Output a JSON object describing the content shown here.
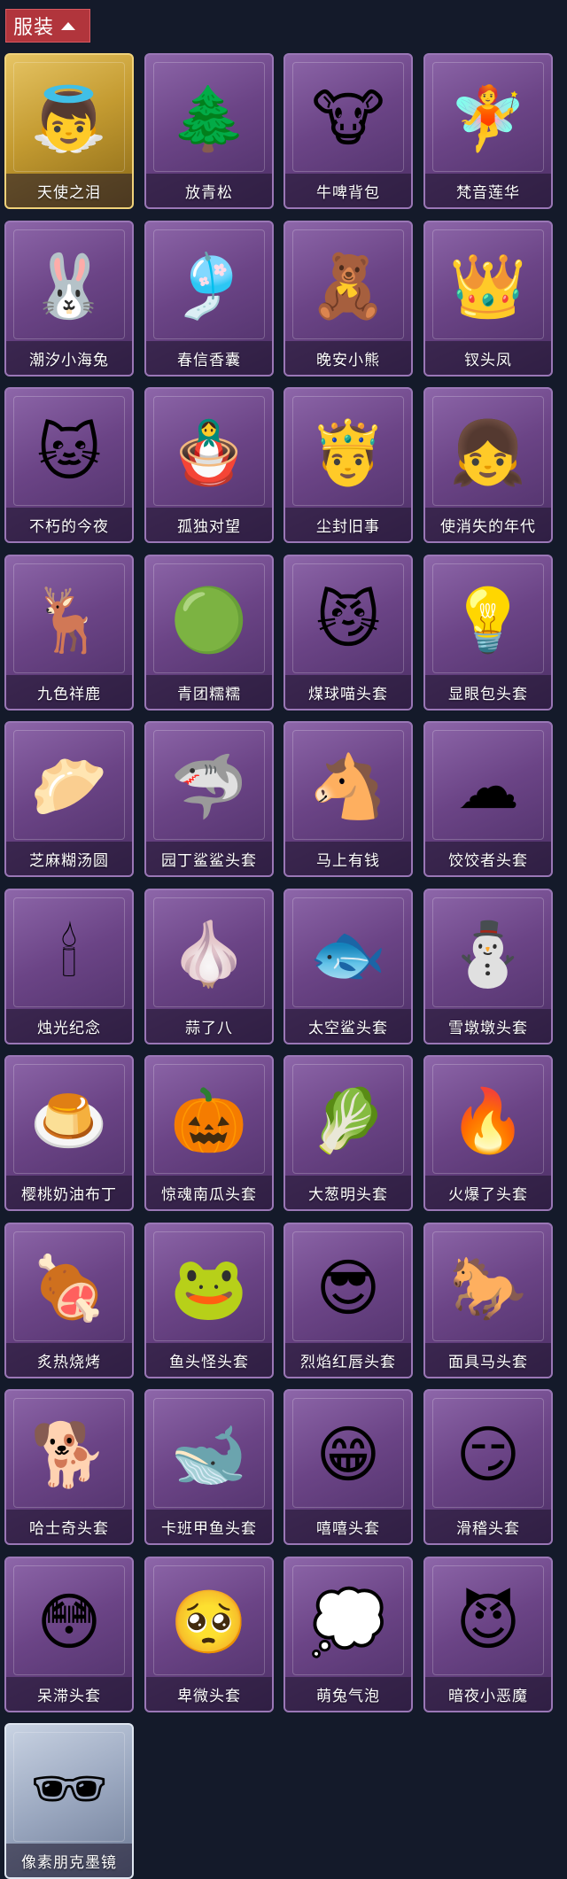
{
  "header": {
    "title": "服装",
    "icon": "caret-up-icon",
    "color": "#b1353c"
  },
  "items": [
    {
      "label": "天使之泪",
      "glyph": "👼",
      "style": "gold"
    },
    {
      "label": "放青松",
      "glyph": "🌲",
      "style": "purple"
    },
    {
      "label": "牛啤背包",
      "glyph": "🐮",
      "style": "purple"
    },
    {
      "label": "梵音莲华",
      "glyph": "🧚",
      "style": "purple"
    },
    {
      "label": "潮汐小海兔",
      "glyph": "🐰",
      "style": "purple"
    },
    {
      "label": "春信香囊",
      "glyph": "🎐",
      "style": "purple"
    },
    {
      "label": "晚安小熊",
      "glyph": "🧸",
      "style": "purple"
    },
    {
      "label": "钗头凤",
      "glyph": "👑",
      "style": "purple"
    },
    {
      "label": "不朽的今夜",
      "glyph": "🐱",
      "style": "purple"
    },
    {
      "label": "孤独对望",
      "glyph": "🪆",
      "style": "purple"
    },
    {
      "label": "尘封旧事",
      "glyph": "🤴",
      "style": "purple"
    },
    {
      "label": "使消失的年代",
      "glyph": "👧",
      "style": "purple"
    },
    {
      "label": "九色祥鹿",
      "glyph": "🦌",
      "style": "purple"
    },
    {
      "label": "青团糯糯",
      "glyph": "🟢",
      "style": "purple"
    },
    {
      "label": "煤球喵头套",
      "glyph": "😼",
      "style": "purple"
    },
    {
      "label": "显眼包头套",
      "glyph": "💡",
      "style": "purple"
    },
    {
      "label": "芝麻糊汤圆",
      "glyph": "🥟",
      "style": "purple"
    },
    {
      "label": "园丁鲨鲨头套",
      "glyph": "🦈",
      "style": "purple"
    },
    {
      "label": "马上有钱",
      "glyph": "🐴",
      "style": "purple"
    },
    {
      "label": "饺饺者头套",
      "glyph": "☁",
      "style": "purple"
    },
    {
      "label": "烛光纪念",
      "glyph": "🕯",
      "style": "purple"
    },
    {
      "label": "蒜了八",
      "glyph": "🧄",
      "style": "purple"
    },
    {
      "label": "太空鲨头套",
      "glyph": "🐟",
      "style": "purple"
    },
    {
      "label": "雪墩墩头套",
      "glyph": "⛄",
      "style": "purple"
    },
    {
      "label": "樱桃奶油布丁",
      "glyph": "🍮",
      "style": "purple"
    },
    {
      "label": "惊魂南瓜头套",
      "glyph": "🎃",
      "style": "purple"
    },
    {
      "label": "大葱明头套",
      "glyph": "🥬",
      "style": "purple"
    },
    {
      "label": "火爆了头套",
      "glyph": "🔥",
      "style": "purple"
    },
    {
      "label": "炙热烧烤",
      "glyph": "🍖",
      "style": "purple"
    },
    {
      "label": "鱼头怪头套",
      "glyph": "🐸",
      "style": "purple"
    },
    {
      "label": "烈焰红唇头套",
      "glyph": "😎",
      "style": "purple"
    },
    {
      "label": "面具马头套",
      "glyph": "🐎",
      "style": "purple"
    },
    {
      "label": "哈士奇头套",
      "glyph": "🐕",
      "style": "purple"
    },
    {
      "label": "卡班甲鱼头套",
      "glyph": "🐋",
      "style": "purple"
    },
    {
      "label": "嘻嘻头套",
      "glyph": "😁",
      "style": "purple"
    },
    {
      "label": "滑稽头套",
      "glyph": "😏",
      "style": "purple"
    },
    {
      "label": "呆滞头套",
      "glyph": "😳",
      "style": "purple"
    },
    {
      "label": "卑微头套",
      "glyph": "🥺",
      "style": "purple"
    },
    {
      "label": "萌兔气泡",
      "glyph": "💭",
      "style": "purple"
    },
    {
      "label": "暗夜小恶魔",
      "glyph": "😈",
      "style": "purple"
    },
    {
      "label": "像素朋克墨镜",
      "glyph": "🕶",
      "style": "blue"
    }
  ]
}
